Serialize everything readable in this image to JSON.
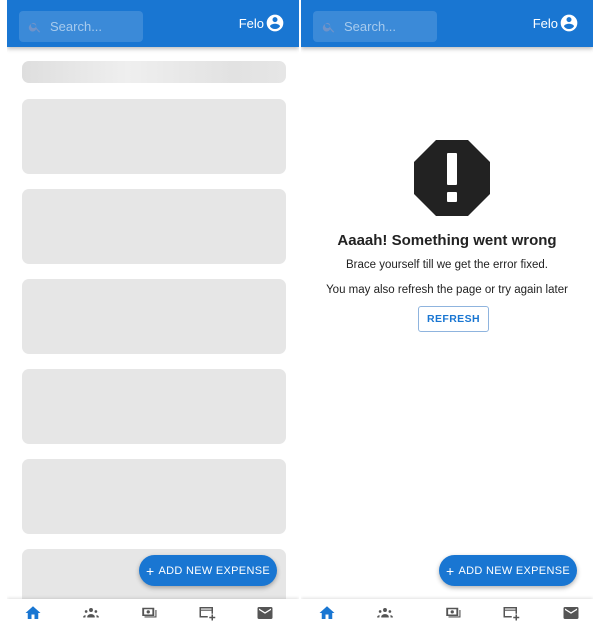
{
  "colors": {
    "primary": "#1976d2",
    "skeleton": "#e6e6e6",
    "icon_dark": "#222222"
  },
  "search": {
    "placeholder": "Search..."
  },
  "user": {
    "name": "Felo",
    "icon": "account-circle-icon"
  },
  "fab": {
    "label": "ADD NEW EXPENSE",
    "icon": "plus-icon"
  },
  "bottom_nav": {
    "items": [
      {
        "name": "home",
        "icon": "home-icon",
        "active": true
      },
      {
        "name": "groups",
        "icon": "people-icon",
        "active": false
      },
      {
        "name": "payments",
        "icon": "money-icon",
        "active": false
      },
      {
        "name": "add-card",
        "icon": "credit-card-add-icon",
        "active": false
      },
      {
        "name": "messages",
        "icon": "mail-icon",
        "active": false
      }
    ]
  },
  "left_screen": {
    "state": "loading",
    "skeleton_cards": 6
  },
  "right_screen": {
    "state": "error",
    "error_icon": "report-octagon-icon",
    "title": "Aaaah! Something went wrong",
    "line1": "Brace yourself till we get the error fixed.",
    "line2": "You may also refresh the page or try again later",
    "refresh_label": "REFRESH"
  }
}
